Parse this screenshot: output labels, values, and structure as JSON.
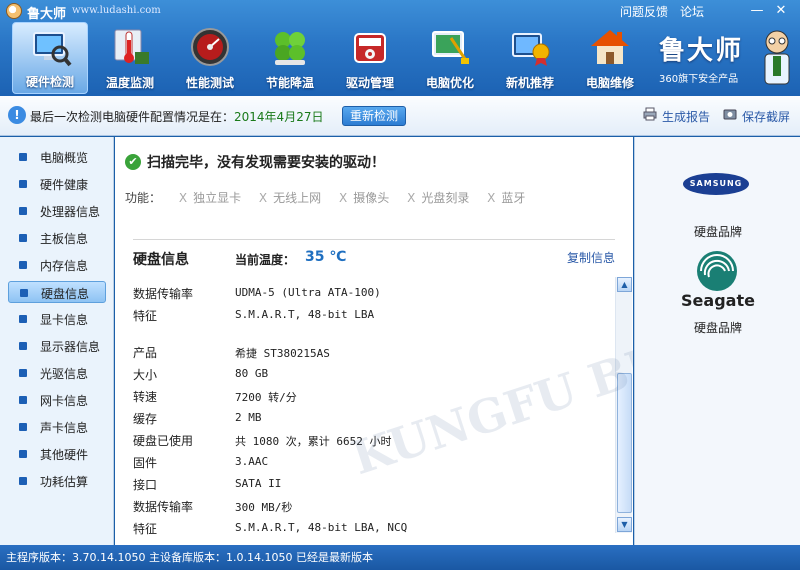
{
  "titlebar": {
    "app_name": "鲁大师",
    "url": "www.ludashi.com",
    "feedback": "问题反馈",
    "forum": "论坛",
    "minimize": "—",
    "close": "✕"
  },
  "nav": {
    "items": [
      {
        "label": "硬件检测",
        "icon": "monitor-magnifier-icon"
      },
      {
        "label": "温度监测",
        "icon": "thermometer-icon"
      },
      {
        "label": "性能测试",
        "icon": "speedometer-icon"
      },
      {
        "label": "节能降温",
        "icon": "clover-icon"
      },
      {
        "label": "驱动管理",
        "icon": "driver-box-icon"
      },
      {
        "label": "电脑优化",
        "icon": "broom-screen-icon"
      },
      {
        "label": "新机推荐",
        "icon": "award-medal-icon"
      },
      {
        "label": "电脑维修",
        "icon": "house-icon"
      }
    ],
    "active_index": 0
  },
  "brand": {
    "name": "鲁大师",
    "subtitle": "360旗下安全产品"
  },
  "infobar": {
    "text": "最后一次检测电脑硬件配置情况是在：",
    "date": "2014年4月27日",
    "recheck": "重新检测",
    "report": "生成报告",
    "screenshot": "保存截屏"
  },
  "sidebar": {
    "items": [
      "电脑概览",
      "硬件健康",
      "处理器信息",
      "主板信息",
      "内存信息",
      "硬盘信息",
      "显卡信息",
      "显示器信息",
      "光驱信息",
      "网卡信息",
      "声卡信息",
      "其他硬件",
      "功耗估算"
    ],
    "active_index": 5
  },
  "main": {
    "scan_result": "扫描完毕，没有发现需要安装的驱动！",
    "func_label": "功能：",
    "func_mark": "X",
    "functions": [
      "独立显卡",
      "无线上网",
      "摄像头",
      "光盘刻录",
      "蓝牙"
    ],
    "panel_title": "硬盘信息",
    "temp_label": "当前温度：",
    "temp_value": "35 ℃",
    "copy": "复制信息",
    "rows": [
      {
        "k": "数据传输率",
        "v": "UDMA-5 (Ultra ATA-100)"
      },
      {
        "k": "特征",
        "v": "S.M.A.R.T,  48-bit LBA"
      },
      {
        "k": "",
        "v": ""
      },
      {
        "k": "产品",
        "v": "希捷 ST380215AS"
      },
      {
        "k": "大小",
        "v": "80 GB"
      },
      {
        "k": "转速",
        "v": "7200 转/分"
      },
      {
        "k": "缓存",
        "v": "2 MB"
      },
      {
        "k": "硬盘已使用",
        "v": "共 1080 次，累计 6652 小时"
      },
      {
        "k": "固件",
        "v": "3.AAC"
      },
      {
        "k": "接口",
        "v": "SATA II"
      },
      {
        "k": "数据传输率",
        "v": "300 MB/秒"
      },
      {
        "k": "特征",
        "v": "S.M.A.R.T,  48-bit LBA,  NCQ"
      }
    ]
  },
  "right_panel": {
    "brand1_logo": "SAMSUNG",
    "brand1_caption": "硬盘品牌",
    "brand2_logo": "Seagate",
    "brand2_caption": "硬盘品牌"
  },
  "statusbar": {
    "text": "主程序版本：3.70.14.1050  主设备库版本：1.0.14.1050  已经是最新版本"
  },
  "watermark": "KUNGFU BBS"
}
